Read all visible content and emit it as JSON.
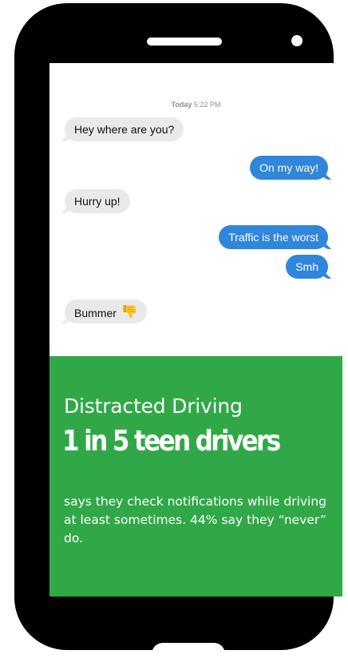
{
  "conversation": {
    "timestamp_day": "Today",
    "timestamp_time": "5:22 PM",
    "messages": [
      {
        "text": "Hey where are you?",
        "direction": "incoming"
      },
      {
        "text": "On my way!",
        "direction": "outgoing"
      },
      {
        "text": "Hurry up!",
        "direction": "incoming"
      },
      {
        "text": "Traffic is the worst",
        "direction": "outgoing"
      },
      {
        "text": "Smh",
        "direction": "outgoing"
      },
      {
        "text": "Bummer",
        "direction": "incoming",
        "icon": "thumbs-down-emoji-icon"
      }
    ]
  },
  "panel": {
    "title": "Distracted Driving",
    "headline": "1 in 5 teen drivers",
    "body": "says they check notifications while driving at least sometimes. 44% say they “never” do."
  },
  "colors": {
    "panel_green": "#31a847",
    "outgoing_bubble": "#2f86db",
    "incoming_bubble": "#e9e9eb",
    "phone_body": "#000000"
  }
}
